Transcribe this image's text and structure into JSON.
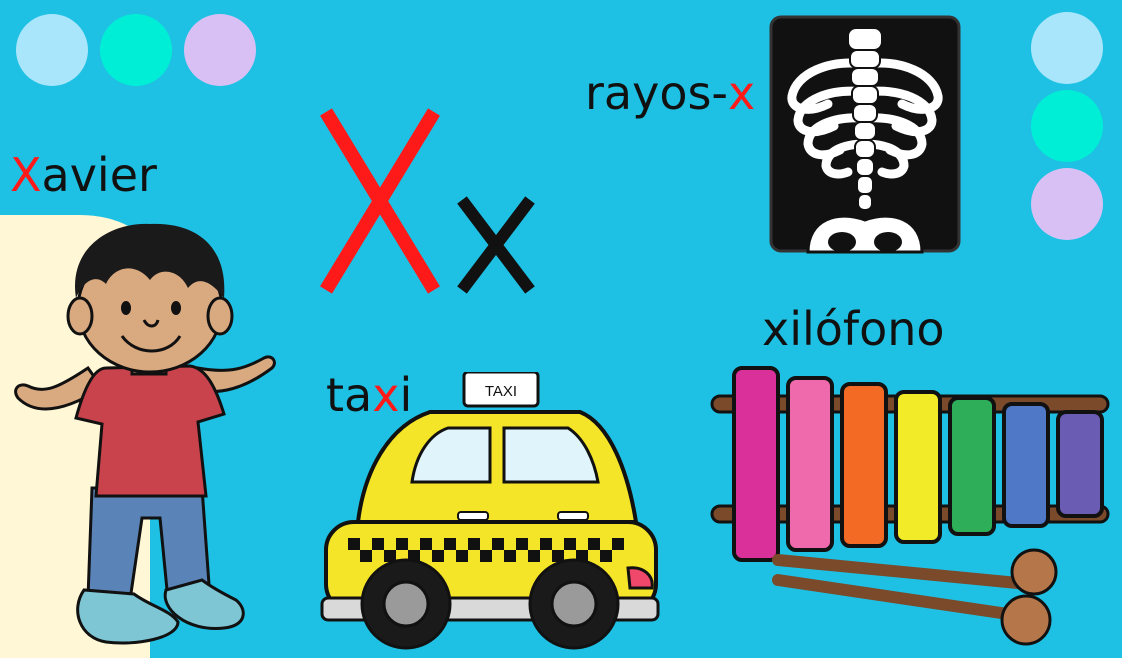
{
  "letters": {
    "upper": "X",
    "lower": "x"
  },
  "words": {
    "xavier": {
      "pre": "",
      "hl": "X",
      "post": "avier"
    },
    "rayos": {
      "pre": "rayos-",
      "hl": "x",
      "post": ""
    },
    "taxi": {
      "pre": "ta",
      "hl": "x",
      "post": "i"
    },
    "xilofono": {
      "pre": "",
      "hl": "",
      "post": "xilófono"
    }
  },
  "taxi_sign": "TAXI",
  "colors": {
    "background": "#1ec1e4",
    "highlight": "#ff1a1a",
    "dot_blue": "#a9e6fb",
    "dot_teal": "#00eed6",
    "dot_lilac": "#d8c0f4",
    "cream_panel": "#fff7d6",
    "taxi_yellow": "#f5e528",
    "xylophone_bars": [
      "#d9309a",
      "#ef6aac",
      "#f36a24",
      "#f2ec28",
      "#2fae5a",
      "#4f78c6",
      "#6a5bb3"
    ]
  }
}
